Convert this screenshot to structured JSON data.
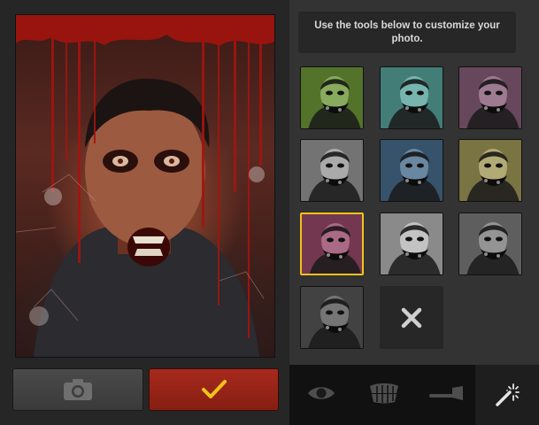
{
  "instruction": "Use the tools below to customize your photo.",
  "icons": {
    "camera": "camera-icon",
    "confirm": "checkmark-icon",
    "remove": "x-icon",
    "eye": "eye-icon",
    "teeth": "teeth-icon",
    "axe": "axe-icon",
    "wand": "magic-wand-icon"
  },
  "colors": {
    "confirm_button": "#a62a1c",
    "selected_border": "#f2c318",
    "checkmark": "#f2c318"
  },
  "filters": [
    {
      "id": "filter-1",
      "tint": "#6f9a3a",
      "selected": false
    },
    {
      "id": "filter-2",
      "tint": "#5aa7a0",
      "selected": false
    },
    {
      "id": "filter-3",
      "tint": "#8a5f7a",
      "selected": false
    },
    {
      "id": "filter-4",
      "tint": "#9a9a9a",
      "selected": false
    },
    {
      "id": "filter-5",
      "tint": "#4a6f8f",
      "selected": false
    },
    {
      "id": "filter-6",
      "tint": "#a39a58",
      "selected": false
    },
    {
      "id": "filter-7",
      "tint": "#9a4a6a",
      "selected": true
    },
    {
      "id": "filter-8",
      "tint": "#b8b8b8",
      "selected": false
    },
    {
      "id": "filter-9",
      "tint": "#7e7e7e",
      "selected": false
    },
    {
      "id": "filter-10",
      "tint": "#585858",
      "selected": false
    }
  ]
}
